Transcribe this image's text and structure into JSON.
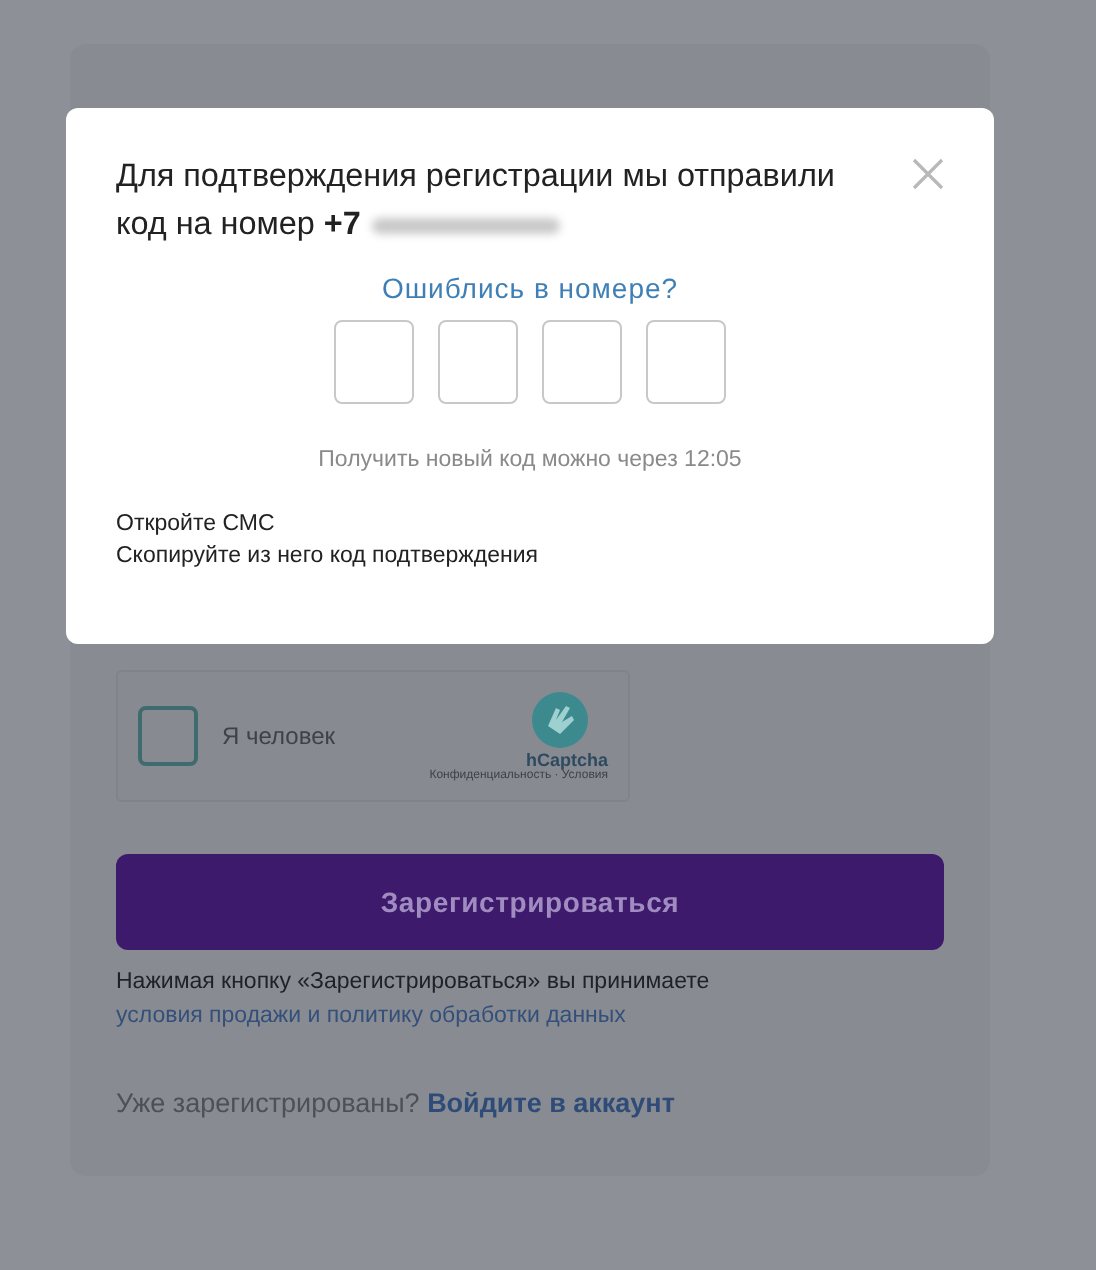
{
  "dialog": {
    "message_lines": [
      "Для подтверждения регистрации мы отправили",
      "код на номер **+7**"
    ],
    "wrong_number_link": "Ошиблись в номере?",
    "resend_timer": "Получить новый код можно через 12:05",
    "instructions": [
      "Откройте СМС",
      "Скопируйте из него код подтверждения"
    ]
  },
  "captcha": {
    "checked": false,
    "label": "Я человек",
    "brand": "hCaptcha",
    "footer": "Конфиденциальность · Условия"
  },
  "register_button": "Зарегистрироваться",
  "terms": {
    "text": "Нажимая кнопку «Зарегистрироваться» вы принимаете",
    "link": "условия продажи и политику обработки данных"
  },
  "login": {
    "prompt": "Уже зарегистрированы?",
    "link": "Войдите в аккаунт"
  }
}
